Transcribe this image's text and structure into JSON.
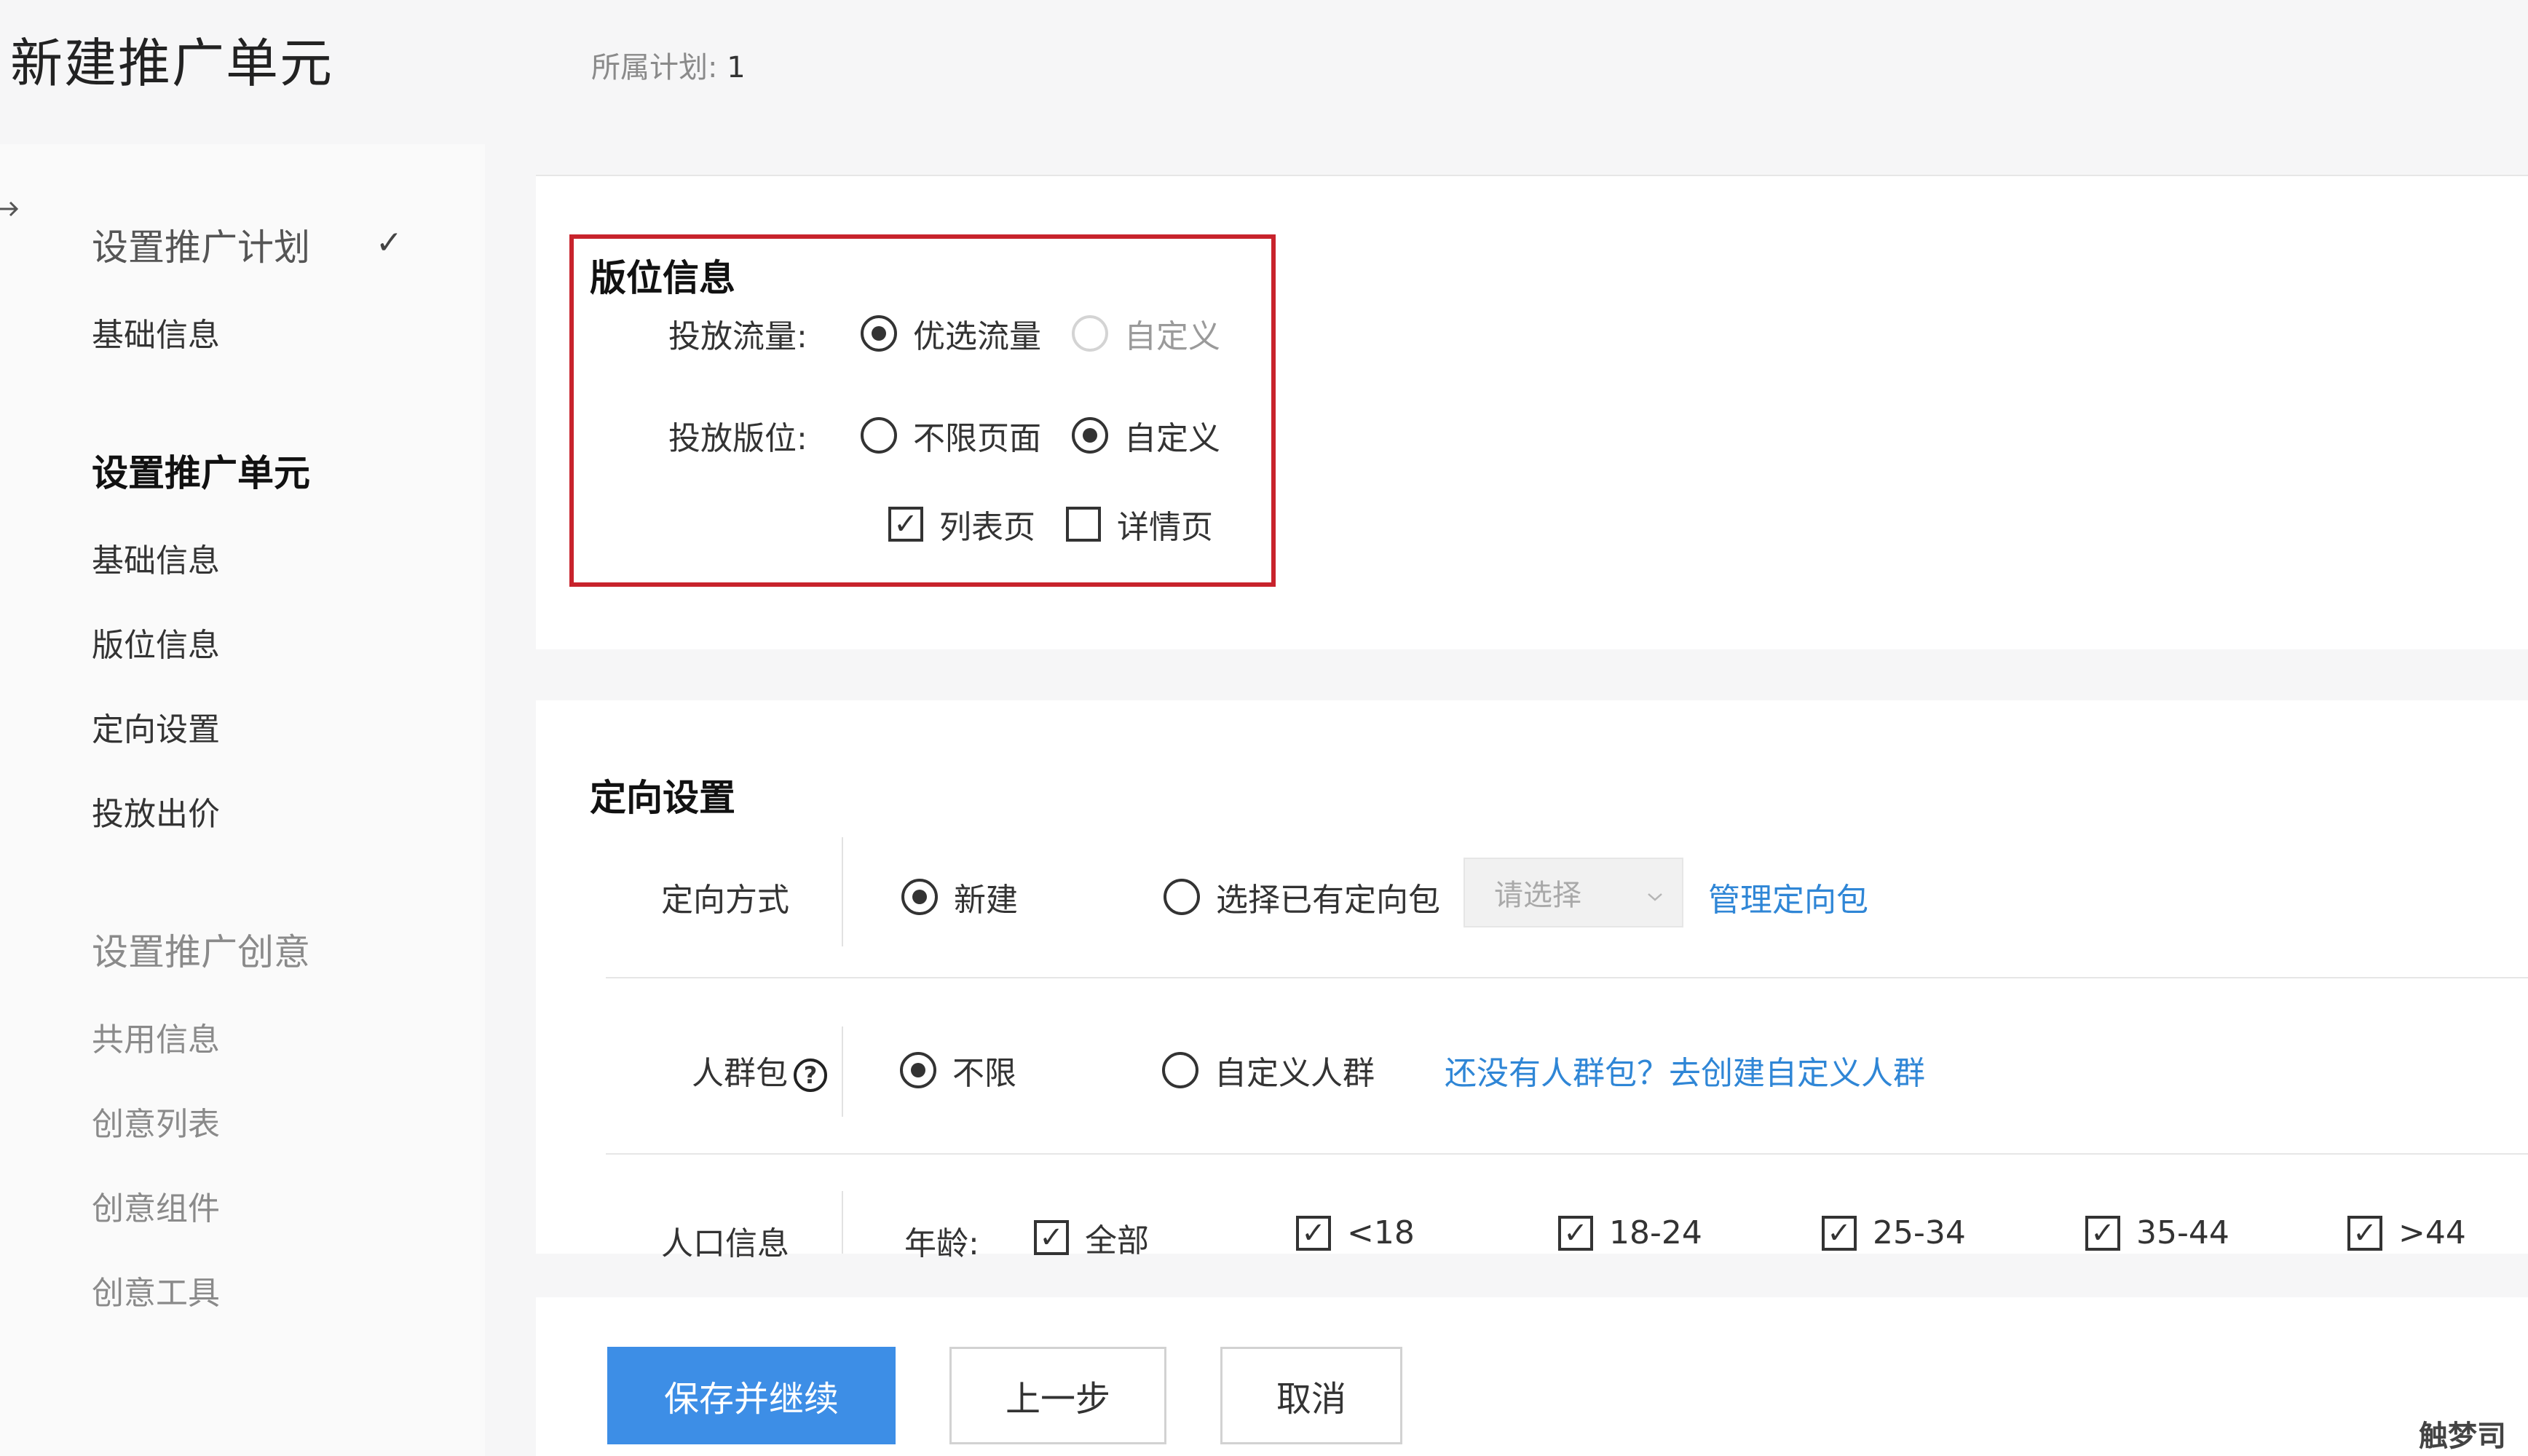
{
  "header": {
    "title": "新建推广单元",
    "plan_label": "所属计划:",
    "plan_value": "1"
  },
  "sidebar": {
    "edge_icon": "arrow-right-icon",
    "groups": [
      {
        "title": "设置推广计划",
        "state": "completed",
        "check": "✓",
        "items": [
          "基础信息"
        ]
      },
      {
        "title": "设置推广单元",
        "state": "active",
        "items": [
          "基础信息",
          "版位信息",
          "定向设置",
          "投放出价"
        ]
      },
      {
        "title": "设置推广创意",
        "state": "pending",
        "items": [
          "共用信息",
          "创意列表",
          "创意组件",
          "创意工具"
        ]
      }
    ]
  },
  "placement": {
    "title": "版位信息",
    "traffic": {
      "label": "投放流量:",
      "options": [
        {
          "label": "优选流量",
          "selected": true,
          "disabled": false
        },
        {
          "label": "自定义",
          "selected": false,
          "disabled": true
        }
      ]
    },
    "position": {
      "label": "投放版位:",
      "options": [
        {
          "label": "不限页面",
          "selected": false
        },
        {
          "label": "自定义",
          "selected": true
        }
      ],
      "pages": [
        {
          "label": "列表页",
          "checked": true
        },
        {
          "label": "详情页",
          "checked": false
        }
      ]
    },
    "highlight_color": "#c8232c"
  },
  "targeting": {
    "title": "定向设置",
    "method": {
      "label": "定向方式",
      "options": [
        {
          "label": "新建",
          "selected": true
        },
        {
          "label": "选择已有定向包",
          "selected": false
        }
      ],
      "select_placeholder": "请选择",
      "manage_link": "管理定向包"
    },
    "audience": {
      "label": "人群包",
      "help_icon": "question-circle-icon",
      "help_glyph": "?",
      "options": [
        {
          "label": "不限",
          "selected": true
        },
        {
          "label": "自定义人群",
          "selected": false
        }
      ],
      "create_link": "还没有人群包？去创建自定义人群"
    },
    "demographics": {
      "label": "人口信息",
      "age_label": "年龄:",
      "ages": [
        {
          "label": "全部",
          "checked": true
        },
        {
          "label": "<18",
          "checked": true
        },
        {
          "label": "18-24",
          "checked": true
        },
        {
          "label": "25-34",
          "checked": true
        },
        {
          "label": "35-44",
          "checked": true
        },
        {
          "label": ">44",
          "checked": true
        }
      ]
    }
  },
  "footer": {
    "save_label": "保存并继续",
    "prev_label": "上一步",
    "cancel_label": "取消"
  },
  "watermark": "触梦司",
  "colors": {
    "primary": "#3d8ee6",
    "link": "#2f86d6",
    "highlight": "#c8232c"
  }
}
